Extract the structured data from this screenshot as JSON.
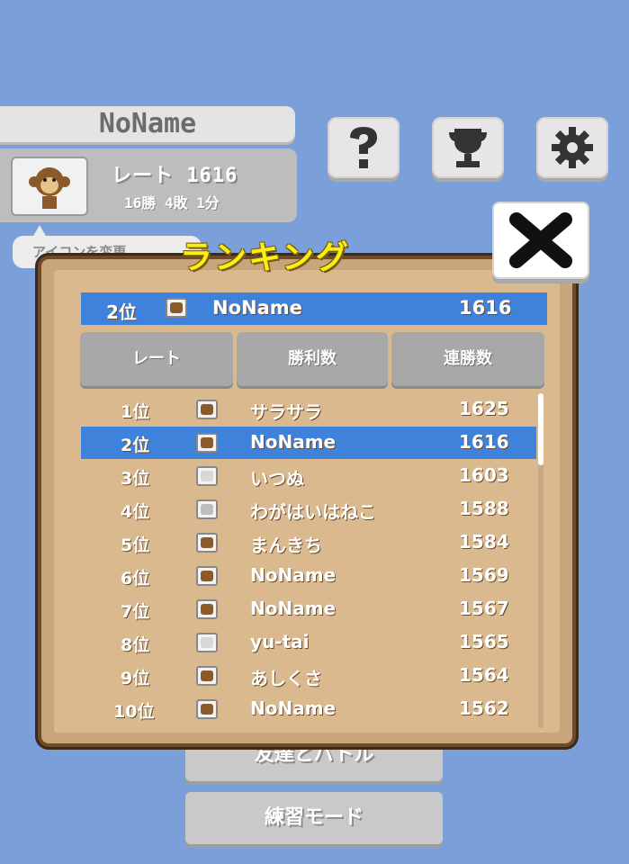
{
  "profile": {
    "name": "NoName",
    "rate_text": "レート 1616",
    "record_text": "16勝 4敗 1分",
    "bubble_text": "アイコンを変更"
  },
  "top_buttons": [
    {
      "name": "help-button",
      "icon": "question-icon"
    },
    {
      "name": "ranking-button",
      "icon": "trophy-icon"
    },
    {
      "name": "settings-button",
      "icon": "gear-icon"
    }
  ],
  "menu": {
    "friend_battle": "友達とバトル",
    "practice": "練習モード"
  },
  "ranking": {
    "title": "ランキング",
    "me": {
      "rank": "2位",
      "name": "NoName",
      "score": "1616"
    },
    "tabs": [
      "レート",
      "勝利数",
      "連勝数"
    ],
    "rows": [
      {
        "rank": "1位",
        "name": "サラサラ",
        "score": "1625",
        "icon": "monkey",
        "self": false
      },
      {
        "rank": "2位",
        "name": "NoName",
        "score": "1616",
        "icon": "monkey",
        "self": true
      },
      {
        "rank": "3位",
        "name": "いつぬ",
        "score": "1603",
        "icon": "dog",
        "self": false
      },
      {
        "rank": "4位",
        "name": "わがはいはねこ",
        "score": "1588",
        "icon": "cat",
        "self": false
      },
      {
        "rank": "5位",
        "name": "まんきち",
        "score": "1584",
        "icon": "monkey",
        "self": false
      },
      {
        "rank": "6位",
        "name": "NoName",
        "score": "1569",
        "icon": "monkey",
        "self": false
      },
      {
        "rank": "7位",
        "name": "NoName",
        "score": "1567",
        "icon": "monkey",
        "self": false
      },
      {
        "rank": "8位",
        "name": "yu-tai",
        "score": "1565",
        "icon": "dog",
        "self": false
      },
      {
        "rank": "9位",
        "name": "あしくさ",
        "score": "1564",
        "icon": "monkey",
        "self": false
      },
      {
        "rank": "10位",
        "name": "NoName",
        "score": "1562",
        "icon": "monkey",
        "self": false
      }
    ]
  },
  "colors": {
    "background": "#7b9fd8",
    "highlight": "#3f82db",
    "title": "#f8f011",
    "panel": "#d9b98d"
  }
}
